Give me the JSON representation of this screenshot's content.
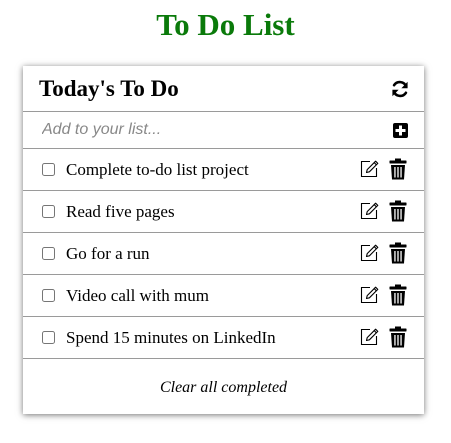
{
  "page": {
    "title": "To Do List",
    "title_color": "#0a7a0a"
  },
  "card": {
    "title": "Today's To Do",
    "refresh_icon": "refresh-icon",
    "add": {
      "placeholder": "Add to your list...",
      "value": "",
      "icon": "plus-square-icon"
    },
    "items": [
      {
        "label": "Complete to-do list project",
        "checked": false
      },
      {
        "label": "Read five pages",
        "checked": false
      },
      {
        "label": "Go for a run",
        "checked": false
      },
      {
        "label": "Video call with mum",
        "checked": false
      },
      {
        "label": "Spend 15 minutes on LinkedIn",
        "checked": false
      }
    ],
    "item_icons": [
      "edit-icon",
      "trash-icon"
    ],
    "footer": {
      "clear_label": "Clear all completed"
    }
  }
}
